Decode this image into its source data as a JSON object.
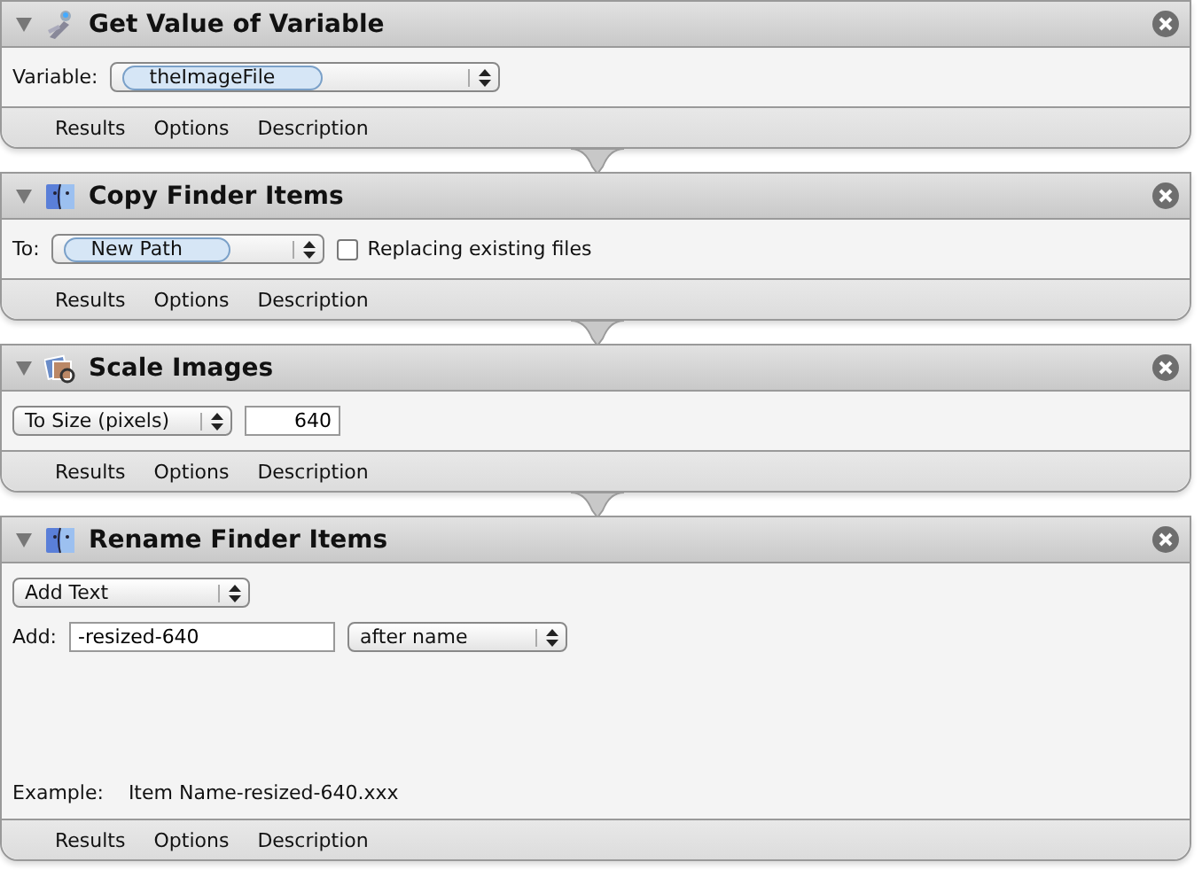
{
  "actions": [
    {
      "title": "Get Value of Variable",
      "expanded": true,
      "rows": [
        [
          {
            "kind": "label",
            "text": "Variable:"
          },
          {
            "kind": "popup",
            "value": "theImageFile",
            "token": true
          }
        ]
      ],
      "tabs": [
        "Results",
        "Options",
        "Description"
      ]
    },
    {
      "title": "Copy Finder Items",
      "expanded": true,
      "rows": [
        [
          {
            "kind": "label",
            "text": "To:"
          },
          {
            "kind": "popup",
            "value": "New Path",
            "token": true
          },
          {
            "kind": "checkbox",
            "text": "Replacing existing files",
            "checked": false
          }
        ]
      ],
      "tabs": [
        "Results",
        "Options",
        "Description"
      ]
    },
    {
      "title": "Scale Images",
      "expanded": true,
      "rows": [
        [
          {
            "kind": "popup",
            "value": "To Size (pixels)",
            "token": false
          },
          {
            "kind": "number",
            "value": "640"
          }
        ]
      ],
      "tabs": [
        "Results",
        "Options",
        "Description"
      ]
    },
    {
      "title": "Rename Finder Items",
      "expanded": true,
      "rows": [
        [
          {
            "kind": "popup",
            "value": "Add Text",
            "token": false
          }
        ],
        [
          {
            "kind": "label",
            "text": "Add:"
          },
          {
            "kind": "text",
            "value": "-resized-640"
          },
          {
            "kind": "popup",
            "value": "after name",
            "token": false
          }
        ]
      ],
      "example": {
        "label": "Example:",
        "value": "Item Name-resized-640.xxx"
      },
      "tabs": [
        "Results",
        "Options",
        "Description"
      ]
    }
  ]
}
